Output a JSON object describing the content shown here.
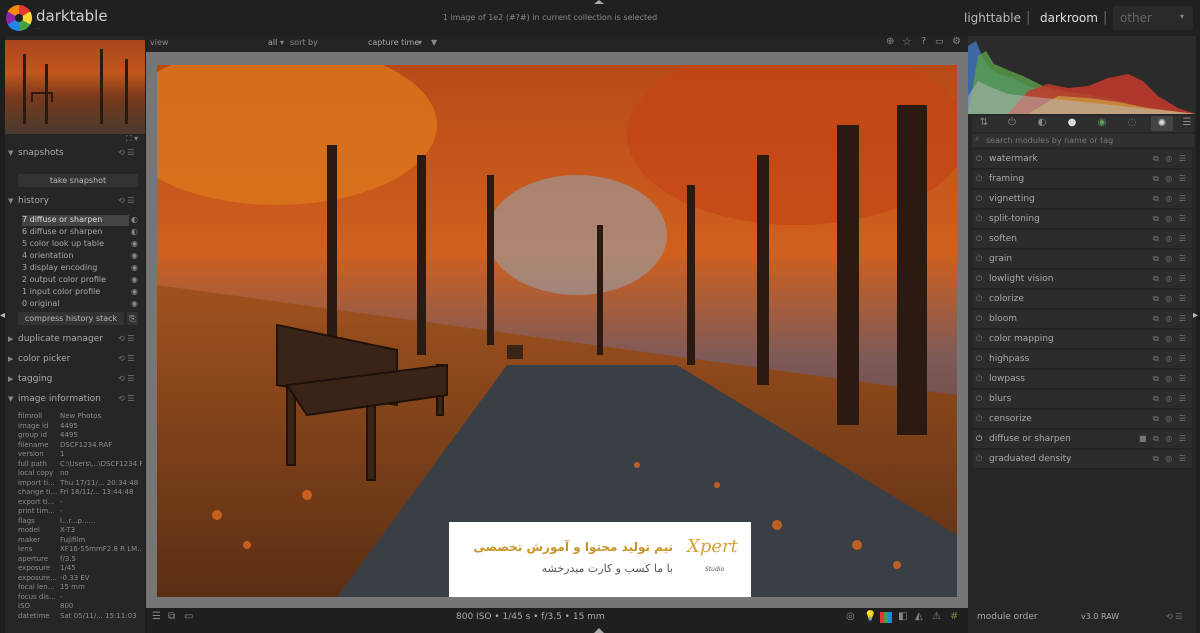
{
  "app": {
    "name": "darktable",
    "tagline": "..."
  },
  "topbar": {
    "collection_info": "1 image of 1e2 (#?#) in current collection is selected",
    "views": [
      "lighttable",
      "darkroom",
      "other"
    ],
    "separator": "|"
  },
  "filterbar": {
    "view_label": "view",
    "filter_value": "all",
    "sort_label": "sort by",
    "sort_value": "capture time",
    "icons": [
      "grouping-icon",
      "star-icon",
      "help-icon",
      "overlay-icon",
      "preferences-icon"
    ]
  },
  "left": {
    "snapshots": {
      "title": "snapshots",
      "take_button": "take snapshot"
    },
    "history": {
      "title": "history",
      "items": [
        {
          "label": "7 diffuse or sharpen",
          "selected": true
        },
        {
          "label": "6 diffuse or sharpen",
          "selected": false
        },
        {
          "label": "5 color look up table",
          "selected": false
        },
        {
          "label": "4 orientation",
          "selected": false
        },
        {
          "label": "3 display encoding",
          "selected": false
        },
        {
          "label": "2 output color profile",
          "selected": false
        },
        {
          "label": "1 input color profile",
          "selected": false
        },
        {
          "label": "0 original",
          "selected": false
        }
      ],
      "compress_button": "compress history stack"
    },
    "sections": [
      "duplicate manager",
      "color picker",
      "tagging",
      "image information"
    ],
    "image_info": [
      {
        "k": "filmroll",
        "v": "New Photos"
      },
      {
        "k": "image id",
        "v": "4495"
      },
      {
        "k": "group id",
        "v": "4495"
      },
      {
        "k": "filename",
        "v": "DSCF1234.RAF"
      },
      {
        "k": "version",
        "v": "1"
      },
      {
        "k": "full path",
        "v": "C:\\Users\\...\\DSCF1234.RAF"
      },
      {
        "k": "local copy",
        "v": "no"
      },
      {
        "k": "import ti...",
        "v": "Thu 17/11/... 20:34:48"
      },
      {
        "k": "change ti...",
        "v": "Fri 18/11/... 13:44:48"
      },
      {
        "k": "export ti...",
        "v": "-"
      },
      {
        "k": "print tim...",
        "v": "-"
      },
      {
        "k": "flags",
        "v": "l...r...p......"
      },
      {
        "k": "model",
        "v": "X-T3"
      },
      {
        "k": "maker",
        "v": "Fujifilm"
      },
      {
        "k": "lens",
        "v": "XF16-55mmF2.8 R LM..."
      },
      {
        "k": "aperture",
        "v": "f/3.5"
      },
      {
        "k": "exposure",
        "v": "1/45"
      },
      {
        "k": "exposure...",
        "v": "-0.33 EV"
      },
      {
        "k": "focal len...",
        "v": "15 mm"
      },
      {
        "k": "focus dis...",
        "v": "-"
      },
      {
        "k": "ISO",
        "v": "800"
      },
      {
        "k": "datetime",
        "v": "Sat 05/11/... 15:11:03"
      }
    ]
  },
  "center": {
    "exif_line": "800 ISO • 1/45 s • f/3.5 • 15 mm",
    "watermark": {
      "line1": "تیم تولید محتوا و آموزش تخصصی",
      "line2": "با ما کسب و کارت میدرخشه",
      "logo": "Xpert",
      "logo_sub": "Studio"
    }
  },
  "right": {
    "search_placeholder": "search modules by name or tag",
    "modules": [
      {
        "name": "watermark",
        "active": false
      },
      {
        "name": "framing",
        "active": false
      },
      {
        "name": "vignetting",
        "active": false
      },
      {
        "name": "split-toning",
        "active": false
      },
      {
        "name": "soften",
        "active": false
      },
      {
        "name": "grain",
        "active": false
      },
      {
        "name": "lowlight vision",
        "active": false
      },
      {
        "name": "colorize",
        "active": false
      },
      {
        "name": "bloom",
        "active": false
      },
      {
        "name": "color mapping",
        "active": false
      },
      {
        "name": "highpass",
        "active": false
      },
      {
        "name": "lowpass",
        "active": false
      },
      {
        "name": "blurs",
        "active": false
      },
      {
        "name": "censorize",
        "active": false
      },
      {
        "name": "diffuse or sharpen",
        "active": true
      },
      {
        "name": "graduated density",
        "active": false
      }
    ],
    "module_order_label": "module order",
    "module_order_value": "v3.0 RAW"
  },
  "colors": {
    "accent_warm": "#c2561e",
    "panel": "#262626",
    "canvas": "#767676"
  }
}
